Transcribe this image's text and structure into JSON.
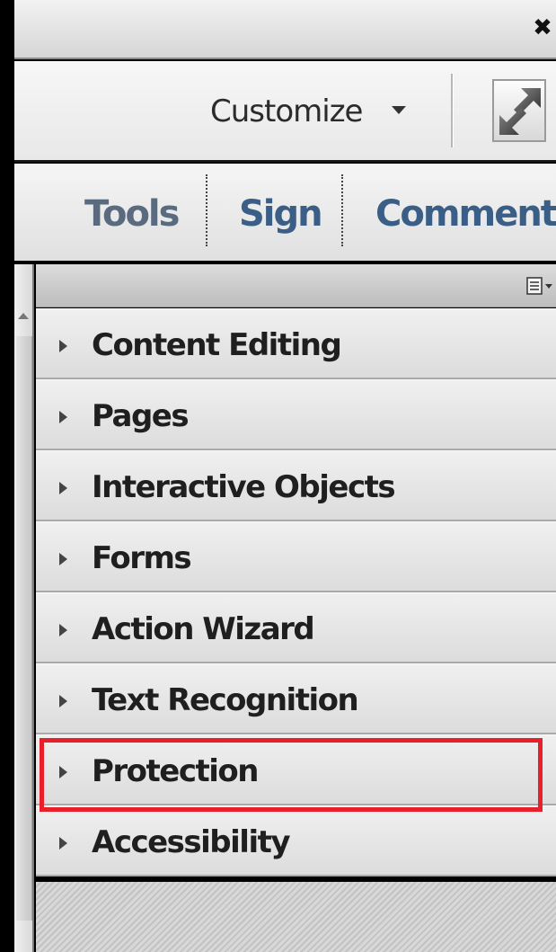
{
  "titlebar": {
    "close_icon": "close-icon"
  },
  "toolbar": {
    "customize_label": "Customize",
    "customize_arrow": "chevron-down-icon",
    "expand_icon": "expand-icon"
  },
  "tabs": [
    {
      "label": "Tools"
    },
    {
      "label": "Sign"
    },
    {
      "label": "Comment"
    }
  ],
  "panel": {
    "menu_icon": "panel-options-icon",
    "items": [
      {
        "label": "Content Editing"
      },
      {
        "label": "Pages"
      },
      {
        "label": "Interactive Objects"
      },
      {
        "label": "Forms"
      },
      {
        "label": "Action Wizard"
      },
      {
        "label": "Text Recognition"
      },
      {
        "label": "Protection",
        "highlighted": true
      },
      {
        "label": "Accessibility"
      }
    ]
  },
  "colors": {
    "highlight": "#e8202a",
    "tab_text": "#3b5e86"
  }
}
